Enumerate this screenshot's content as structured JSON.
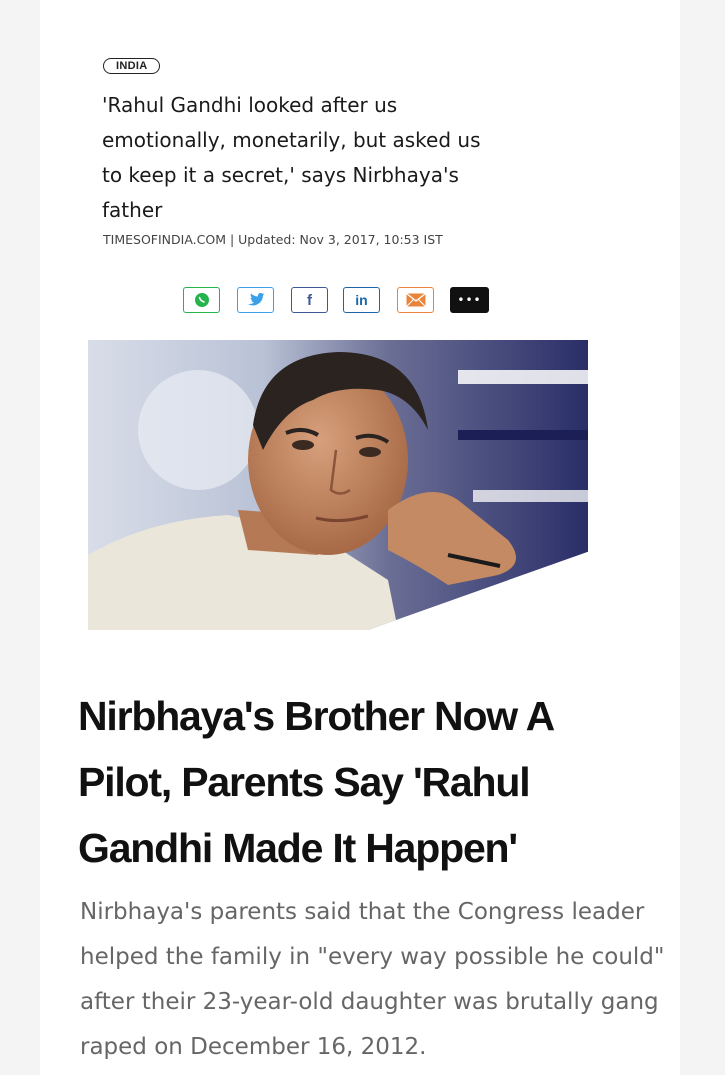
{
  "article": {
    "category": "INDIA",
    "headline": "'Rahul Gandhi looked after us emotionally, monetarily, but asked us to keep it a secret,' says Nirbhaya's father",
    "headline_lines": [
      "'Rahul Gandhi looked after us",
      "emotionally, monetarily, but asked us",
      "to keep it a secret,' says Nirbhaya's",
      "father"
    ],
    "byline": "TIMESOFINDIA.COM | Updated: Nov 3, 2017, 10:53 IST"
  },
  "share": {
    "buttons": [
      {
        "name": "whatsapp-icon",
        "color": "#25b34b"
      },
      {
        "name": "twitter-icon",
        "color": "#3aa0e8"
      },
      {
        "name": "facebook-icon",
        "color": "#3b5998",
        "glyph": "f"
      },
      {
        "name": "linkedin-icon",
        "color": "#1a66a8",
        "glyph": "in"
      },
      {
        "name": "email-icon",
        "color": "#e8853a"
      },
      {
        "name": "more-icon",
        "color": "#111111",
        "glyph": "•••"
      }
    ]
  },
  "story": {
    "title_lines": [
      "Nirbhaya's Brother Now A",
      "Pilot, Parents Say 'Rahul",
      "Gandhi Made It Happen'"
    ],
    "summary_lines": [
      "Nirbhaya's parents said that the Congress leader",
      "helped the family in \"every way possible he could\"",
      "after their 23-year-old daughter was brutally gang",
      "raped on December 16, 2012."
    ]
  }
}
